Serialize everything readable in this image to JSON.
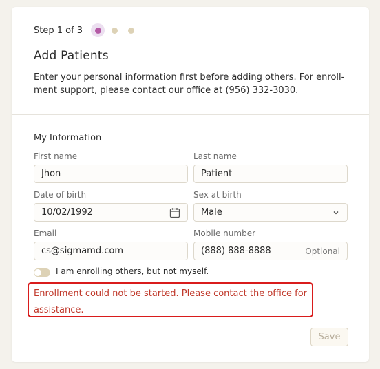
{
  "stepper": {
    "label": "Step 1 of 3",
    "active_color": "#b45aa5",
    "inactive_color": "#ddd2b6"
  },
  "header": {
    "title": "Add Patients",
    "description": "Enter your personal information first before adding others. For enroll-ment support, please contact our office at (956) 332-3030."
  },
  "form": {
    "section_title": "My Information",
    "first_name": {
      "label": "First name",
      "value": "Jhon"
    },
    "last_name": {
      "label": "Last name",
      "value": "Patient"
    },
    "dob": {
      "label": "Date of birth",
      "value": "10/02/1992",
      "icon": "calendar-icon"
    },
    "sex": {
      "label": "Sex at birth",
      "value": "Male",
      "icon": "chevron-down-icon"
    },
    "email": {
      "label": "Email",
      "value": "cs@sigmamd.com"
    },
    "mobile": {
      "label": "Mobile number",
      "value": "(888) 888-8888",
      "suffix": "Optional"
    },
    "toggle": {
      "label": "I am enrolling others, but not myself.",
      "checked": false
    }
  },
  "error": {
    "message": "Enrollment could not be started. Please contact the office for assistance.",
    "color": "#c0392b",
    "border_color": "#d91c1c"
  },
  "actions": {
    "save_label": "Save"
  }
}
